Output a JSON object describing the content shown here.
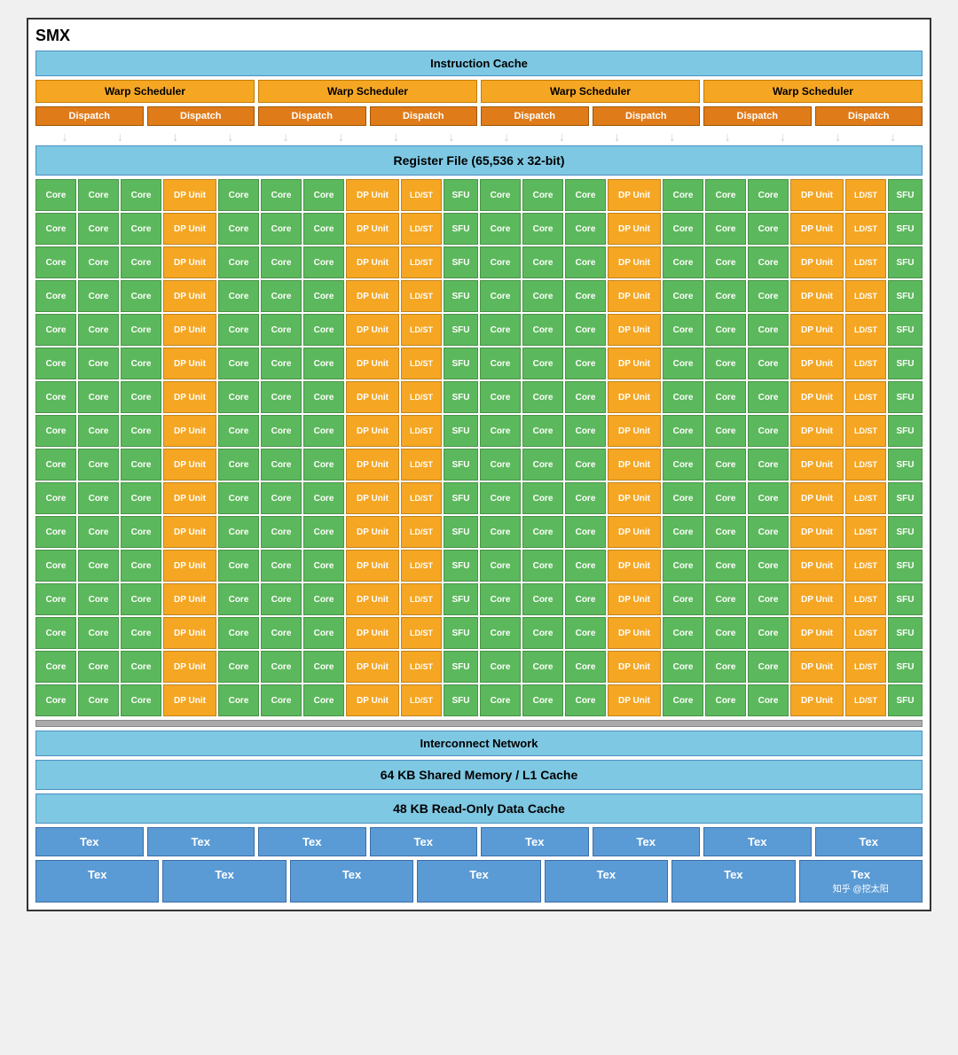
{
  "title": "SMX",
  "instruction_cache": "Instruction Cache",
  "warp_schedulers": [
    "Warp Scheduler",
    "Warp Scheduler",
    "Warp Scheduler",
    "Warp Scheduler"
  ],
  "dispatch_units": [
    "Dispatch",
    "Dispatch",
    "Dispatch",
    "Dispatch",
    "Dispatch",
    "Dispatch",
    "Dispatch",
    "Dispatch"
  ],
  "register_file": "Register File (65,536 x 32-bit)",
  "interconnect": "Interconnect Network",
  "shared_memory": "64 KB Shared Memory / L1 Cache",
  "readonly_cache": "48 KB Read-Only Data Cache",
  "tex_units_row1": [
    "Tex",
    "Tex",
    "Tex",
    "Tex",
    "Tex",
    "Tex",
    "Tex",
    "Tex"
  ],
  "tex_units_row2": [
    "Tex",
    "Tex",
    "Tex",
    "Tex",
    "Tex",
    "Tex",
    "T知乎 @挖太阳"
  ],
  "num_core_rows": 16,
  "colors": {
    "core": "#5cb85c",
    "dp_unit": "#f5a623",
    "ldst": "#f5a623",
    "sfu": "#5cb85c",
    "warp": "#f5a623",
    "dispatch": "#e07b1a",
    "cache": "#7ec8e3",
    "tex": "#5b9bd5"
  }
}
